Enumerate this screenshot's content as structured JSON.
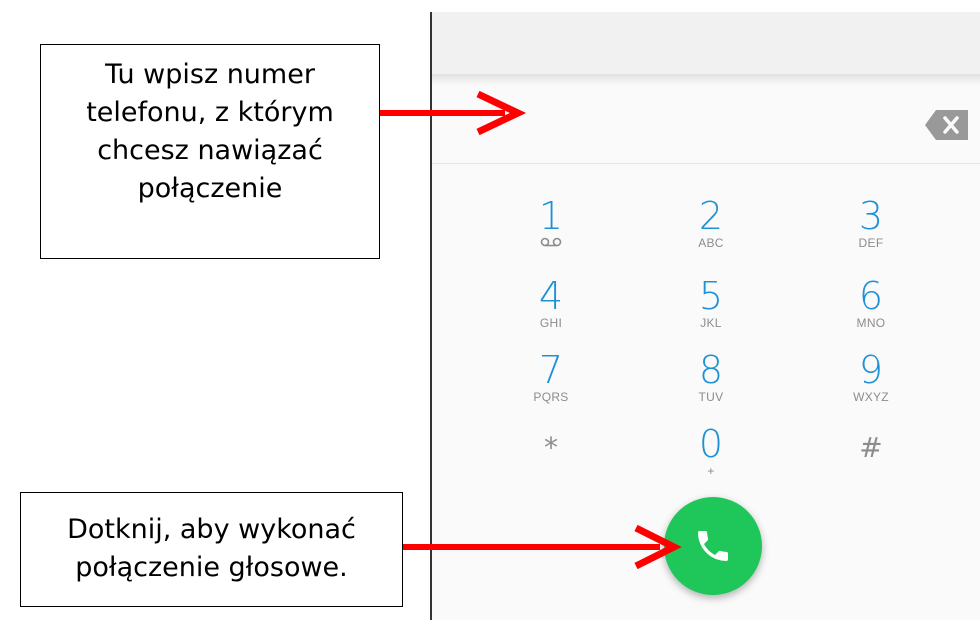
{
  "annotations": {
    "top": {
      "lines": [
        "Tu wpisz numer",
        "telefonu, z którym",
        "chcesz nawiązać",
        "połączenie"
      ]
    },
    "bottom": {
      "lines": [
        "Dotknij, aby wykonać",
        "połączenie głosowe."
      ]
    },
    "arrow_color": "#ff0000"
  },
  "dialer": {
    "number_value": "",
    "accent_color": "#1e91d6",
    "call_button_color": "#1fc75a",
    "keys": [
      {
        "digit": "1",
        "letters": "",
        "icon": "voicemail-icon"
      },
      {
        "digit": "2",
        "letters": "ABC"
      },
      {
        "digit": "3",
        "letters": "DEF"
      },
      {
        "digit": "4",
        "letters": "GHI"
      },
      {
        "digit": "5",
        "letters": "JKL"
      },
      {
        "digit": "6",
        "letters": "MNO"
      },
      {
        "digit": "7",
        "letters": "PQRS"
      },
      {
        "digit": "8",
        "letters": "TUV"
      },
      {
        "digit": "9",
        "letters": "WXYZ"
      },
      {
        "digit": "*",
        "letters": ""
      },
      {
        "digit": "0",
        "letters": "+"
      },
      {
        "digit": "#",
        "letters": ""
      }
    ]
  }
}
